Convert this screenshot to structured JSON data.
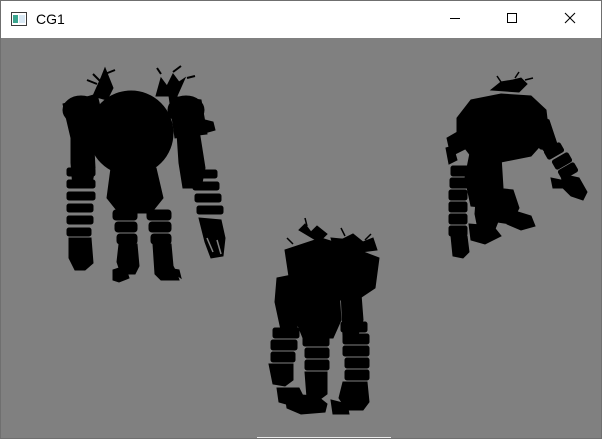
{
  "window": {
    "title": "CG1",
    "background_color": "#808080",
    "titlebar_color": "#ffffff"
  },
  "titlebar": {
    "app_icon": "window-app-icon",
    "buttons": [
      {
        "name": "minimize",
        "icon": "minimize-icon"
      },
      {
        "name": "maximize",
        "icon": "maximize-icon"
      },
      {
        "name": "close",
        "icon": "close-icon"
      }
    ]
  },
  "scene": {
    "figure_color": "#000000",
    "figures": [
      {
        "name": "robot-front-view"
      },
      {
        "name": "robot-side-view"
      },
      {
        "name": "robot-lower-view"
      }
    ]
  }
}
